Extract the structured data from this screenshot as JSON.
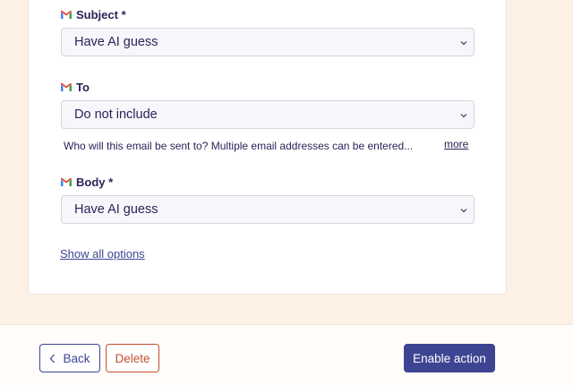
{
  "fields": {
    "subject": {
      "label": "Subject *",
      "value": "Have AI guess"
    },
    "to": {
      "label": "To",
      "value": "Do not include",
      "help": "Who will this email be sent to? Multiple email addresses can be entered...",
      "more": "more"
    },
    "body": {
      "label": "Body *",
      "value": "Have AI guess"
    }
  },
  "show_all_options": "Show all options",
  "footer": {
    "back": "Back",
    "delete": "Delete",
    "enable": "Enable action"
  },
  "icons": {
    "field": "gmail-icon",
    "dropdown": "chevron-down-icon",
    "back": "chevron-left-icon"
  },
  "colors": {
    "primary": "#3d4592",
    "danger": "#c4502f",
    "text": "#2b2358",
    "page_bg": "#fdf1e5"
  }
}
